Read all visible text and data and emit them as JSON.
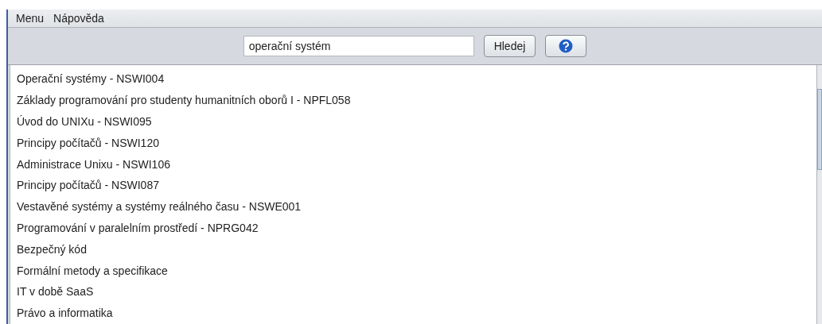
{
  "menu": [
    "Menu",
    "Nápověda"
  ],
  "search": {
    "value": "operační systém",
    "button": "Hledej"
  },
  "results": [
    "Operační systémy - NSWI004",
    "Základy programování pro studenty humanitních oborů I - NPFL058",
    "Úvod do UNIXu - NSWI095",
    "Principy počítačů - NSWI120",
    "Administrace Unixu - NSWI106",
    "Principy počítačů - NSWI087",
    "Vestavěné systémy a systémy reálného času - NSWE001",
    "Programování v paralelním prostředí - NPRG042",
    "Bezpečný kód",
    "Formální metody a specifikace",
    "IT v době SaaS",
    "Právo a informatika"
  ]
}
